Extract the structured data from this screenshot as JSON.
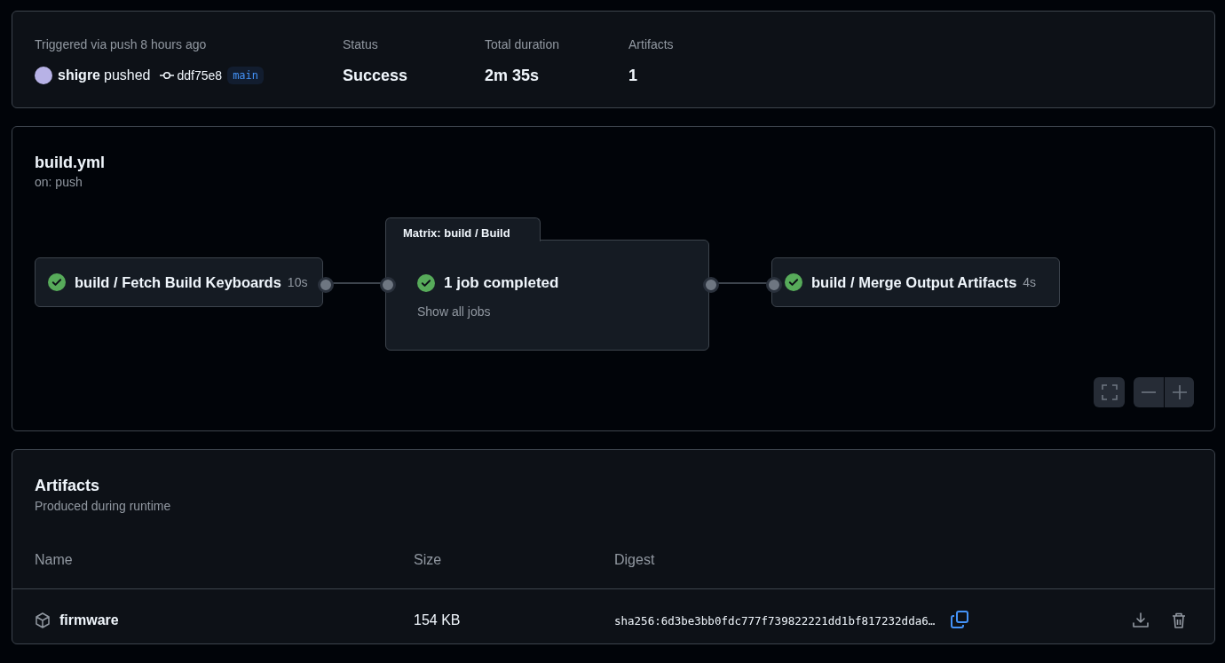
{
  "run": {
    "trigger": "Triggered via push 8 hours ago",
    "actor": "shigre",
    "action": "pushed",
    "commit": "ddf75e8",
    "branch": "main"
  },
  "summary": [
    {
      "label": "Status",
      "value": "Success"
    },
    {
      "label": "Total duration",
      "value": "2m 35s"
    },
    {
      "label": "Artifacts",
      "value": "1"
    }
  ],
  "workflow": {
    "title": "build.yml",
    "subtitle": "on: push",
    "nodes": [
      {
        "kind": "job",
        "name": "build / Fetch Build Keyboards",
        "duration": "10s",
        "passed": true
      },
      {
        "kind": "matrix",
        "title": "Matrix: build / Build",
        "summary": "1 job completed",
        "link": "Show all jobs",
        "passed": true
      },
      {
        "kind": "job",
        "name": "build / Merge Output Artifacts",
        "duration": "4s",
        "passed": true
      }
    ]
  },
  "artifacts": {
    "title": "Artifacts",
    "subtitle": "Produced during runtime",
    "columns": [
      "Name",
      "Size",
      "Digest"
    ],
    "rows": [
      {
        "name": "firmware",
        "size": "154 KB",
        "digest": "sha256:6d3be3bb0fdc777f739822221dd1bf817232dda6…"
      }
    ]
  }
}
